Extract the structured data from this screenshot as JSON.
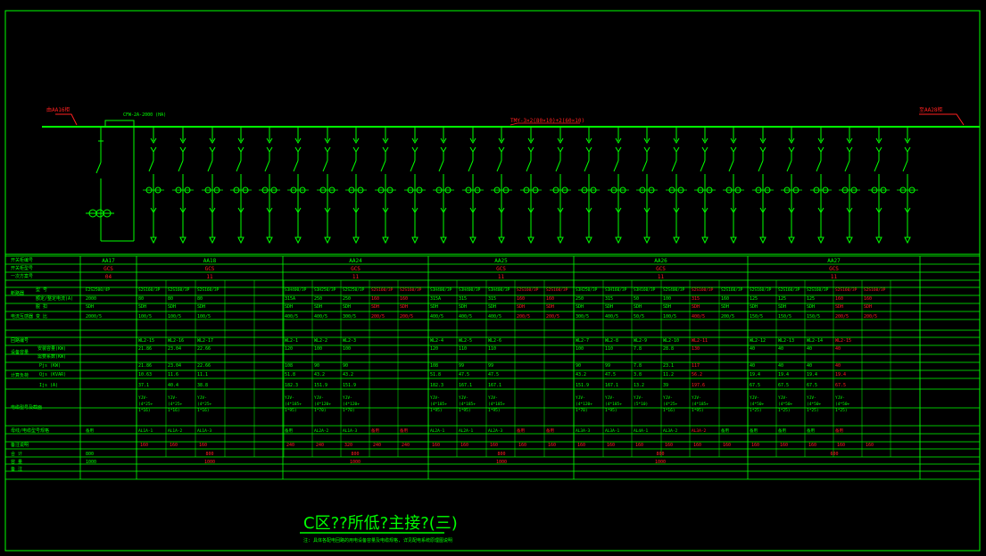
{
  "diagram": {
    "labels": {
      "bus_left": "由AA16柜",
      "bus_right": "至AA28柜",
      "cpu_note": "CFW-2A-2000 (HA)",
      "busbar": "TMY-3×2(80×10)+2(60×10)"
    },
    "title": "C区??所低?主接?(三)",
    "subtitle": "注: 具体各配电回路的用电设备容量及电缆规格, 详见配电系统原理图说明"
  },
  "colors": {
    "green": "#00ff00",
    "red": "#ff2020",
    "white": "#ffffff",
    "bg": "#000000"
  },
  "table": {
    "row_labels": [
      "开关柜编号",
      "开关柜型号",
      "一次方案号",
      "断路器",
      "",
      "电流互感器",
      "",
      "回路编号",
      "设备容量",
      "",
      "计算负荷",
      "",
      "",
      "",
      "电缆型号及截面",
      "母线/电缆型号规格",
      "备注说明",
      "合  计",
      "容  量",
      "备  注"
    ],
    "sub_labels": {
      "breaker": [
        "型  号",
        "额定/整定电流(A)",
        "脱  扣",
        "变  比"
      ],
      "calc": [
        "Pjs  (KW)",
        "Qjs  (KVAR)",
        "Ijs  (A)"
      ],
      "cap": [
        "安装容量(KW)",
        "需要系数(KW)"
      ],
      "cable_head": "母线规格"
    },
    "cabinets": [
      {
        "id": "AA17",
        "model": "GCS",
        "scheme": "04"
      },
      {
        "id": "AA18",
        "model": "GCS",
        "scheme": "11"
      },
      {
        "id": "AA24",
        "model": "GCS",
        "scheme": "11"
      },
      {
        "id": "AA25",
        "model": "GCS",
        "scheme": "11"
      },
      {
        "id": "AA26",
        "model": "GCS",
        "scheme": "11"
      },
      {
        "id": "AA27",
        "model": "GCS",
        "scheme": "11"
      }
    ],
    "breaker_model": [
      "E2S2500/4P",
      "S2S160/3P",
      "S2S160/3P",
      "S2S160/3P",
      "S3H400/3P",
      "S3H250/3P",
      "S2S250/3P",
      "S2S160/3P",
      "S2S160/3P",
      "S3H400/3P",
      "S3H400/3P",
      "S3H400/3P",
      "S2S160/3P",
      "S2S160/3P",
      "S3H250/3P",
      "S3H160/3P",
      "S3H160/3P",
      "S2S400/3P",
      "S2S160/3P",
      "S2S160/3P",
      "S2S160/3P",
      "S2S160/3P",
      "S2S160/3P",
      "S2S160/3P",
      "S2S160/3P"
    ],
    "rated_current": [
      "2000",
      "80",
      "80",
      "80",
      "315A",
      "250",
      "250",
      "160",
      "160",
      "315A",
      "315",
      "315",
      "160",
      "160",
      "250",
      "315",
      "50",
      "100",
      "315",
      "160",
      "125",
      "125",
      "125",
      "160",
      "160"
    ],
    "trip": [
      "SDH",
      "SDH",
      "SDH",
      "SDH",
      "SDH",
      "SDH",
      "SDH",
      "SDH",
      "SDH",
      "SDH",
      "SDH",
      "SDH",
      "SDH",
      "SDH",
      "SDH",
      "SDH",
      "SDH",
      "SDH",
      "SDH",
      "SDH",
      "SDH",
      "SDH",
      "SDH",
      "SDH",
      "SDH"
    ],
    "ct_ratio": [
      "2000/5",
      "100/5",
      "100/5",
      "100/5",
      "400/5",
      "400/5",
      "300/5",
      "200/5",
      "200/5",
      "400/5",
      "400/5",
      "400/5",
      "200/5",
      "200/5",
      "300/5",
      "400/5",
      "50/5",
      "100/5",
      "400/5",
      "200/5",
      "150/5",
      "150/5",
      "150/5",
      "200/5",
      "200/5"
    ],
    "circuit": [
      "",
      "WL2-15",
      "WL2-16",
      "WL2-17",
      "WL2-1",
      "WL2-2",
      "WL2-3",
      "",
      "",
      "WL2-4",
      "WL2-5",
      "WL2-6",
      "",
      "",
      "WL2-7",
      "WL2-8",
      "WL2-9",
      "WL2-10",
      "WL2-11",
      "",
      "WL2-12",
      "WL2-13",
      "WL2-14",
      "WL2-15",
      ""
    ],
    "cap_install": [
      "",
      "21.86",
      "23.04",
      "22.66",
      "120",
      "100",
      "100",
      "",
      "",
      "120",
      "110",
      "110",
      "",
      "",
      "100",
      "110",
      "7.8",
      "28.8",
      "130",
      "",
      "40",
      "40",
      "40",
      "40",
      ""
    ],
    "pjs": [
      "",
      "21.86",
      "23.04",
      "22.66",
      "108",
      "90",
      "90",
      "",
      "",
      "108",
      "99",
      "99",
      "",
      "",
      "90",
      "99",
      "7.8",
      "23.1",
      "117",
      "",
      "40",
      "40",
      "40",
      "40",
      ""
    ],
    "qjs": [
      "",
      "10.63",
      "11.6",
      "11.1",
      "51.8",
      "43.2",
      "43.2",
      "",
      "",
      "51.8",
      "47.5",
      "47.5",
      "",
      "",
      "43.2",
      "47.5",
      "3.8",
      "11.2",
      "56.2",
      "",
      "19.4",
      "19.4",
      "19.4",
      "19.4",
      ""
    ],
    "ijs": [
      "",
      "37.1",
      "40.4",
      "38.8",
      "182.3",
      "151.9",
      "151.9",
      "",
      "",
      "182.3",
      "167.1",
      "167.1",
      "",
      "",
      "151.9",
      "167.1",
      "13.2",
      "39",
      "197.6",
      "",
      "67.5",
      "67.5",
      "67.5",
      "67.5",
      ""
    ],
    "cable": [
      "",
      "YJV-(4*25+1*16)",
      "YJV-(4*25+1*16)",
      "YJV-(4*25+1*16)",
      "YJV-(4*185+1*95)",
      "YJV-(4*120+1*70)",
      "YJV-(4*120+1*70)",
      "",
      "",
      "YJV-(4*185+1*95)",
      "YJV-(4*185+1*95)",
      "YJV-(4*185+1*95)",
      "",
      "",
      "YJV-(4*120+1*70)",
      "YJV-(4*185+1*95)",
      "YJV-(5*10)",
      "YJV-(4*25+1*16)",
      "YJV-(4*185+1*95)",
      "",
      "YJV-(4*50+1*25)",
      "YJV-(4*50+1*25)",
      "YJV-(4*50+1*25)",
      "YJV-(4*50+1*25)",
      ""
    ],
    "remark": [
      "备用",
      "AL1A-1",
      "AL1A-2",
      "AL1A-3",
      "备用",
      "AL2A-2",
      "AL1A-3",
      "备用",
      "备用",
      "AL2A-1",
      "AL2A-1",
      "AL2A-3",
      "备用",
      "备用",
      "AL3A-3",
      "AL3A-1",
      "AL4A-1",
      "AL3A-2",
      "AL3A-2",
      "备用",
      "备用",
      "备用",
      "备用",
      "备用",
      ""
    ],
    "height": [
      "",
      "160",
      "160",
      "160",
      "240",
      "240",
      "320",
      "240",
      "240",
      "160",
      "160",
      "160",
      "160",
      "160",
      "160",
      "160",
      "160",
      "160",
      "160",
      "160",
      "160",
      "160",
      "160",
      "160",
      "160"
    ],
    "totals": {
      "sum_label": "800",
      "cap_label": "1000",
      "sum": [
        "800",
        "800",
        "800",
        "800",
        "600"
      ],
      "cap": [
        "1000",
        "1000",
        "1000",
        "1000"
      ]
    },
    "red_cells": [
      7,
      8,
      12,
      13,
      18,
      23,
      24
    ]
  }
}
